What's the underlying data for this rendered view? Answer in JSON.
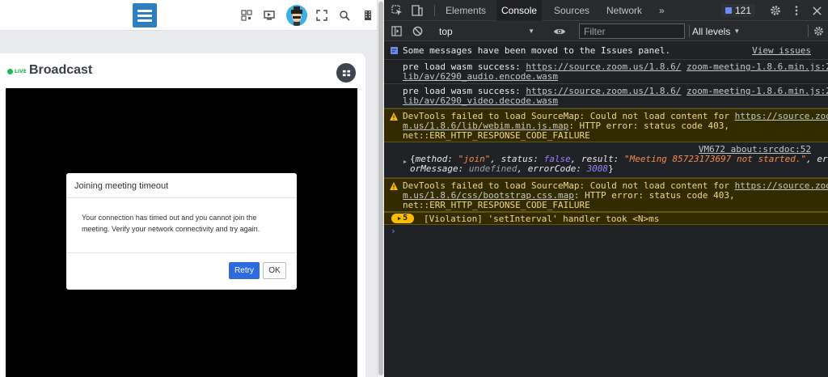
{
  "page": {
    "title": "Broadcast",
    "live_badge": "LIVE"
  },
  "modal": {
    "title": "Joining meeting timeout",
    "body": "Your connection has timed out and you cannot join the meeting. Verify your network connectivity and try again.",
    "retry_label": "Retry",
    "ok_label": "OK"
  },
  "devtools": {
    "tabs": [
      {
        "label": "Elements"
      },
      {
        "label": "Console"
      },
      {
        "label": "Sources"
      },
      {
        "label": "Network"
      }
    ],
    "more_tabs": "»",
    "issues_count": "121",
    "context": "top",
    "filter_placeholder": "Filter",
    "levels": "All levels"
  },
  "console": {
    "issues_moved": "Some messages have been moved to the Issues panel.",
    "view_issues": "View issues",
    "log1": {
      "line1_prefix": "pre load wasm success: ",
      "line1_link": "https://source.zoom.us/1.8.6/",
      "line1_src": "zoom-meeting-1.8.6.min.js:2",
      "line2": "lib/av/6290_audio.encode.wasm"
    },
    "log2": {
      "line1_prefix": "pre load wasm success: ",
      "line1_link": "https://source.zoom.us/1.8.6/",
      "line1_src": "zoom-meeting-1.8.6.min.js:2",
      "line2": "lib/av/6290_video.decode.wasm"
    },
    "warn1": {
      "line1_prefix": "DevTools failed to load SourceMap: Could not load content for ",
      "line1_link": "https://source.zoo",
      "line2_link": "m.us/1.8.6/lib/webim.min.js.map",
      "line2_rest": ": HTTP error: status code 403,",
      "line3": "net::ERR_HTTP_RESPONSE_CODE_FAILURE"
    },
    "obj": {
      "source": "VM672 about:srcdoc:52",
      "open": "{",
      "k1": "method: ",
      "v1": "\"join\"",
      "k2": ", status: ",
      "v2": "false",
      "k3": ", result: ",
      "v3": "\"Meeting 85723173697 not started.\"",
      "k4": ", err",
      "line2_a": "orMessage: ",
      "line2_b": "undefined",
      "line2_c": ", errorCode: ",
      "line2_d": "3008",
      "close": "}"
    },
    "warn2": {
      "line1_prefix": "DevTools failed to load SourceMap: Could not load content for ",
      "line1_link": "https://source.zoo",
      "line2_link": "m.us/1.8.6/css/bootstrap.css.map",
      "line2_rest": ": HTTP error: status code 403,",
      "line3": "net::ERR_HTTP_RESPONSE_CODE_FAILURE"
    },
    "violation": {
      "count": "5",
      "text": "[Violation] 'setInterval' handler took <N>ms"
    },
    "prompt": "›"
  },
  "colors": {
    "brand_blue": "#2e7fc1",
    "retry_blue": "#2d6ade",
    "live_green": "#1db954",
    "devtools_bg": "#202124",
    "warning_bg": "#332b00",
    "warning_text": "#f2d68a",
    "violation_badge": "#fbbc04"
  },
  "icons": [
    "hamburger-menu-icon",
    "qr-code-icon",
    "screen-share-icon",
    "fullscreen-icon",
    "search-icon",
    "film-icon",
    "grid-view-icon",
    "inspect-element-icon",
    "device-toggle-icon",
    "gear-icon",
    "kebab-menu-icon",
    "sidebar-toggle-icon",
    "clear-console-icon",
    "eye-icon",
    "warning-icon"
  ]
}
